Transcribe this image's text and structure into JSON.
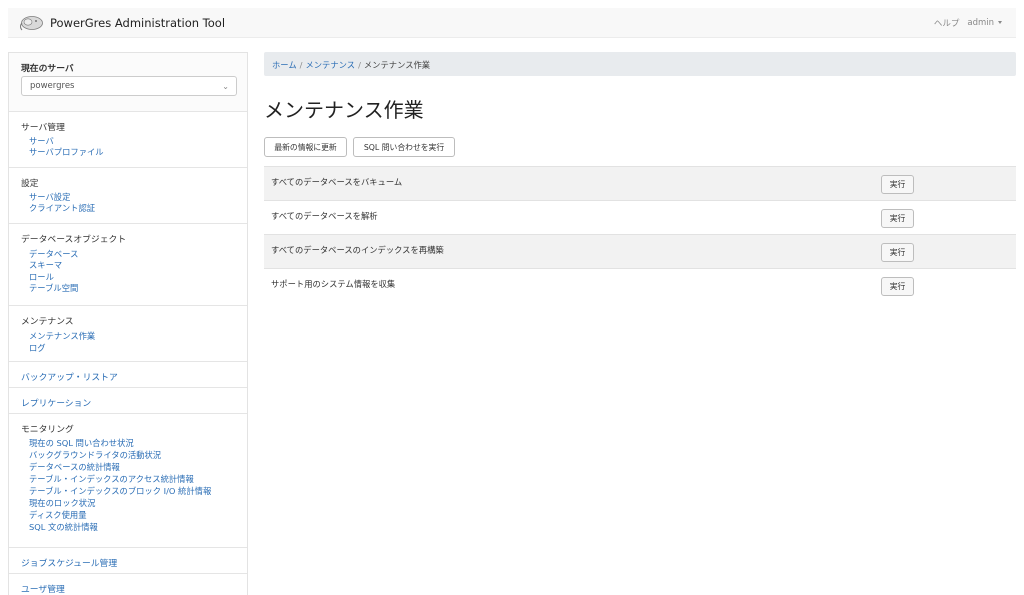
{
  "app": {
    "title": "PowerGres Administration Tool",
    "help_label": "ヘルプ",
    "user_label": "admin"
  },
  "colors": {
    "link": "#2a6db5",
    "navbar_bg": "#f8f8f8",
    "breadcrumb_bg": "#e8ebee",
    "row_alt_bg": "#f2f2f2"
  },
  "sidebar": {
    "current_server": {
      "title": "現在のサーバ",
      "selected": "powergres"
    },
    "server_mgmt": {
      "title": "サーバ管理",
      "items": [
        "サーバ",
        "サーバプロファイル"
      ]
    },
    "settings": {
      "title": "設定",
      "items": [
        "サーバ設定",
        "クライアント認証"
      ]
    },
    "db_objects": {
      "title": "データベースオブジェクト",
      "items": [
        "データベース",
        "スキーマ",
        "ロール",
        "テーブル空間"
      ]
    },
    "maintenance": {
      "title": "メンテナンス",
      "items": [
        "メンテナンス作業",
        "ログ"
      ]
    },
    "backup_restore": "バックアップ・リストア",
    "replication": "レプリケーション",
    "monitoring": {
      "title": "モニタリング",
      "items": [
        "現在の SQL 問い合わせ状況",
        "バックグラウンドライタの活動状況",
        "データベースの統計情報",
        "テーブル・インデックスのアクセス統計情報",
        "テーブル・インデックスのブロック I/O 統計情報",
        "現在のロック状況",
        "ディスク使用量",
        "SQL 文の統計情報"
      ]
    },
    "job_schedule": "ジョブスケジュール管理",
    "user_mgmt": "ユーザ管理"
  },
  "breadcrumb": {
    "home": "ホーム",
    "maintenance": "メンテナンス",
    "current": "メンテナンス作業",
    "separator": "/"
  },
  "page": {
    "title": "メンテナンス作業",
    "refresh_button": "最新の情報に更新",
    "sql_button": "SQL 問い合わせを実行"
  },
  "tasks": [
    {
      "label": "すべてのデータベースをバキューム",
      "button": "実行"
    },
    {
      "label": "すべてのデータベースを解析",
      "button": "実行"
    },
    {
      "label": "すべてのデータベースのインデックスを再構築",
      "button": "実行"
    },
    {
      "label": "サポート用のシステム情報を収集",
      "button": "実行"
    }
  ]
}
